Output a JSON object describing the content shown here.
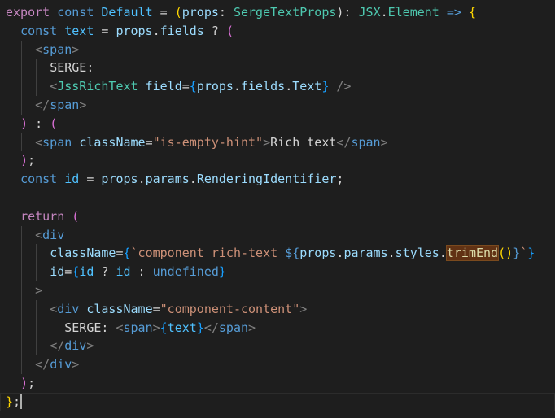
{
  "theme": {
    "background": "#1e1e1e",
    "keyword": "#569cd6",
    "control": "#c586c0",
    "variable": "#9cdcfe",
    "constant": "#4fc1ff",
    "function": "#dcdcaa",
    "type": "#4ec9b0",
    "string": "#ce9178",
    "tag": "#569cd6",
    "bracket": "#808080",
    "plain": "#d4d4d4",
    "brace_gold": "#ffd700",
    "brace_pink": "#da70d6",
    "brace_blue": "#179fff",
    "highlight": "#613214"
  },
  "code_lines": [
    [
      [
        "export",
        "control"
      ],
      [
        " ",
        "plain"
      ],
      [
        "const",
        "keyword"
      ],
      [
        " ",
        "plain"
      ],
      [
        "Default",
        "constant"
      ],
      [
        " = ",
        "plain"
      ],
      [
        "(",
        "brace_gold"
      ],
      [
        "props",
        "variable"
      ],
      [
        ": ",
        "plain"
      ],
      [
        "SergeTextProps",
        "type"
      ],
      [
        "): ",
        "plain"
      ],
      [
        "JSX",
        "type"
      ],
      [
        ".",
        "plain"
      ],
      [
        "Element",
        "type"
      ],
      [
        " ",
        "plain"
      ],
      [
        "=>",
        "keyword"
      ],
      [
        " ",
        "plain"
      ],
      [
        "{",
        "brace_gold"
      ]
    ],
    [
      [
        "  ",
        "plain"
      ],
      [
        "const",
        "keyword"
      ],
      [
        " ",
        "plain"
      ],
      [
        "text",
        "constant"
      ],
      [
        " = ",
        "plain"
      ],
      [
        "props",
        "variable"
      ],
      [
        ".",
        "plain"
      ],
      [
        "fields",
        "variable"
      ],
      [
        " ? ",
        "plain"
      ],
      [
        "(",
        "brace_pink"
      ]
    ],
    [
      [
        "    ",
        "plain"
      ],
      [
        "<",
        "bracket"
      ],
      [
        "span",
        "tag"
      ],
      [
        ">",
        "bracket"
      ]
    ],
    [
      [
        "      ",
        "plain"
      ],
      [
        "SERGE:",
        "plain"
      ]
    ],
    [
      [
        "      ",
        "plain"
      ],
      [
        "<",
        "bracket"
      ],
      [
        "JssRichText",
        "type"
      ],
      [
        " ",
        "plain"
      ],
      [
        "field",
        "variable"
      ],
      [
        "=",
        "plain"
      ],
      [
        "{",
        "brace_blue"
      ],
      [
        "props",
        "variable"
      ],
      [
        ".",
        "plain"
      ],
      [
        "fields",
        "variable"
      ],
      [
        ".",
        "plain"
      ],
      [
        "Text",
        "variable"
      ],
      [
        "}",
        "brace_blue"
      ],
      [
        " ",
        "plain"
      ],
      [
        "/>",
        "bracket"
      ]
    ],
    [
      [
        "    ",
        "plain"
      ],
      [
        "</",
        "bracket"
      ],
      [
        "span",
        "tag"
      ],
      [
        ">",
        "bracket"
      ]
    ],
    [
      [
        "  ",
        "plain"
      ],
      [
        ")",
        "brace_pink"
      ],
      [
        " : ",
        "plain"
      ],
      [
        "(",
        "brace_pink"
      ]
    ],
    [
      [
        "    ",
        "plain"
      ],
      [
        "<",
        "bracket"
      ],
      [
        "span",
        "tag"
      ],
      [
        " ",
        "plain"
      ],
      [
        "className",
        "variable"
      ],
      [
        "=",
        "plain"
      ],
      [
        "\"is-empty-hint\"",
        "string"
      ],
      [
        ">",
        "bracket"
      ],
      [
        "Rich text",
        "plain"
      ],
      [
        "</",
        "bracket"
      ],
      [
        "span",
        "tag"
      ],
      [
        ">",
        "bracket"
      ]
    ],
    [
      [
        "  ",
        "plain"
      ],
      [
        ")",
        "brace_pink"
      ],
      [
        ";",
        "plain"
      ]
    ],
    [
      [
        "  ",
        "plain"
      ],
      [
        "const",
        "keyword"
      ],
      [
        " ",
        "plain"
      ],
      [
        "id",
        "constant"
      ],
      [
        " = ",
        "plain"
      ],
      [
        "props",
        "variable"
      ],
      [
        ".",
        "plain"
      ],
      [
        "params",
        "variable"
      ],
      [
        ".",
        "plain"
      ],
      [
        "RenderingIdentifier",
        "variable"
      ],
      [
        ";",
        "plain"
      ]
    ],
    [],
    [
      [
        "  ",
        "plain"
      ],
      [
        "return",
        "control"
      ],
      [
        " ",
        "plain"
      ],
      [
        "(",
        "brace_pink"
      ]
    ],
    [
      [
        "    ",
        "plain"
      ],
      [
        "<",
        "bracket"
      ],
      [
        "div",
        "tag"
      ]
    ],
    [
      [
        "      ",
        "plain"
      ],
      [
        "className",
        "variable"
      ],
      [
        "=",
        "plain"
      ],
      [
        "{",
        "brace_blue"
      ],
      [
        "`component rich-text ",
        "string"
      ],
      [
        "${",
        "keyword"
      ],
      [
        "props",
        "variable"
      ],
      [
        ".",
        "plain"
      ],
      [
        "params",
        "variable"
      ],
      [
        ".",
        "plain"
      ],
      [
        "styles",
        "variable"
      ],
      [
        ".",
        "plain"
      ],
      [
        "trimEnd",
        "function",
        true
      ],
      [
        "(",
        "brace_gold"
      ],
      [
        ")",
        "brace_gold"
      ],
      [
        "}",
        "keyword"
      ],
      [
        "`",
        "string"
      ],
      [
        "}",
        "brace_blue"
      ]
    ],
    [
      [
        "      ",
        "plain"
      ],
      [
        "id",
        "variable"
      ],
      [
        "=",
        "plain"
      ],
      [
        "{",
        "brace_blue"
      ],
      [
        "id",
        "constant"
      ],
      [
        " ? ",
        "plain"
      ],
      [
        "id",
        "constant"
      ],
      [
        " : ",
        "plain"
      ],
      [
        "undefined",
        "keyword"
      ],
      [
        "}",
        "brace_blue"
      ]
    ],
    [
      [
        "    ",
        "plain"
      ],
      [
        ">",
        "bracket"
      ]
    ],
    [
      [
        "      ",
        "plain"
      ],
      [
        "<",
        "bracket"
      ],
      [
        "div",
        "tag"
      ],
      [
        " ",
        "plain"
      ],
      [
        "className",
        "variable"
      ],
      [
        "=",
        "plain"
      ],
      [
        "\"component-content\"",
        "string"
      ],
      [
        ">",
        "bracket"
      ]
    ],
    [
      [
        "        ",
        "plain"
      ],
      [
        "SERGE: ",
        "plain"
      ],
      [
        "<",
        "bracket"
      ],
      [
        "span",
        "tag"
      ],
      [
        ">",
        "bracket"
      ],
      [
        "{",
        "brace_blue"
      ],
      [
        "text",
        "constant"
      ],
      [
        "}",
        "brace_blue"
      ],
      [
        "</",
        "bracket"
      ],
      [
        "span",
        "tag"
      ],
      [
        ">",
        "bracket"
      ]
    ],
    [
      [
        "      ",
        "plain"
      ],
      [
        "</",
        "bracket"
      ],
      [
        "div",
        "tag"
      ],
      [
        ">",
        "bracket"
      ]
    ],
    [
      [
        "    ",
        "plain"
      ],
      [
        "</",
        "bracket"
      ],
      [
        "div",
        "tag"
      ],
      [
        ">",
        "bracket"
      ]
    ],
    [
      [
        "  ",
        "plain"
      ],
      [
        ")",
        "brace_pink"
      ],
      [
        ";",
        "plain"
      ]
    ],
    [
      [
        "}",
        "brace_gold"
      ],
      [
        ";",
        "plain"
      ]
    ]
  ]
}
